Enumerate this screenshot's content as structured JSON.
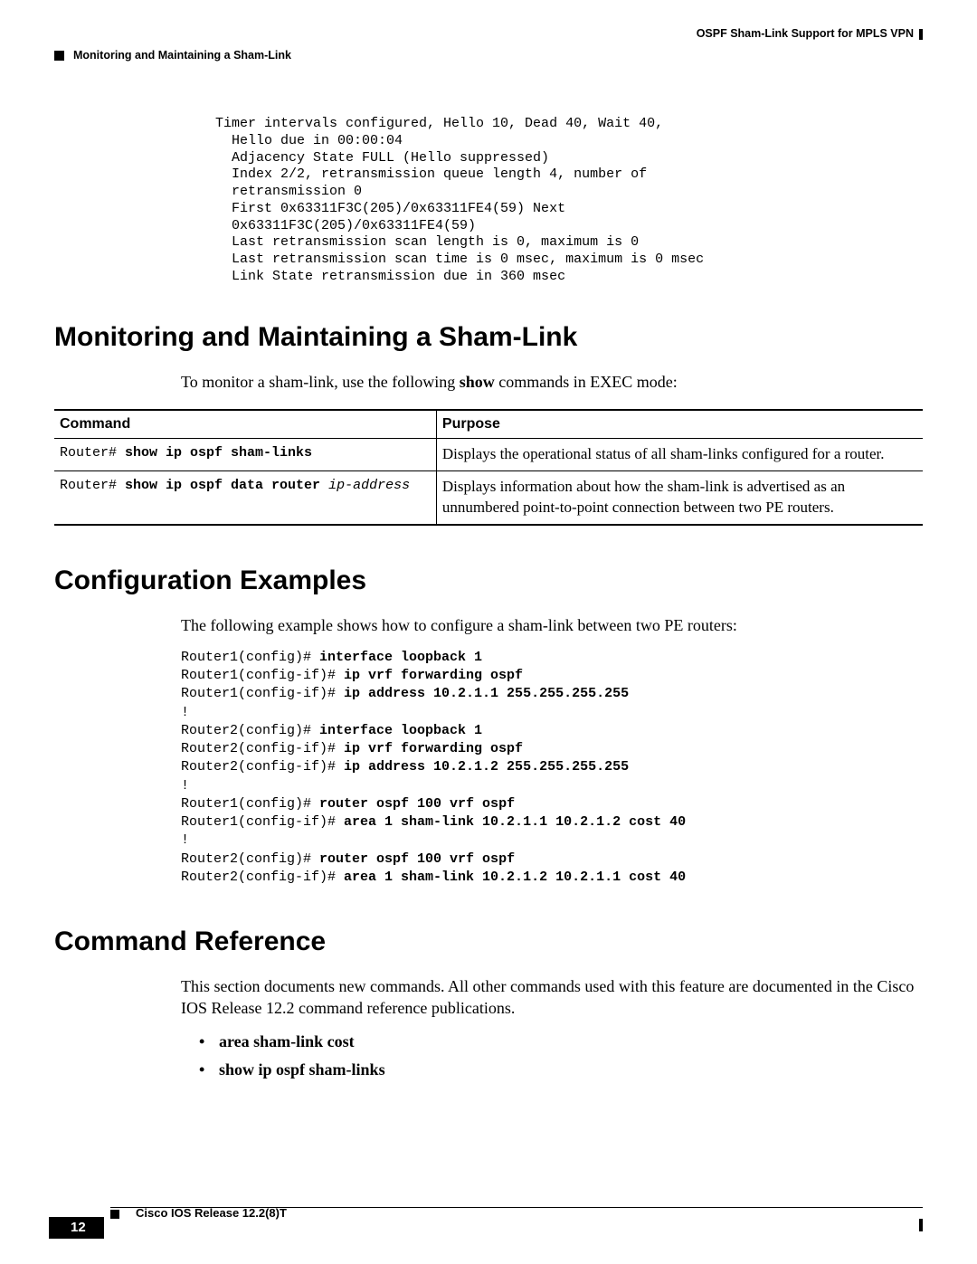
{
  "header": {
    "right": "OSPF Sham-Link Support for MPLS VPN",
    "left": "Monitoring and Maintaining a Sham-Link"
  },
  "pre_block": "  Timer intervals configured, Hello 10, Dead 40, Wait 40,\n    Hello due in 00:00:04\n    Adjacency State FULL (Hello suppressed)\n    Index 2/2, retransmission queue length 4, number of\n    retransmission 0\n    First 0x63311F3C(205)/0x63311FE4(59) Next\n    0x63311F3C(205)/0x63311FE4(59)\n    Last retransmission scan length is 0, maximum is 0\n    Last retransmission scan time is 0 msec, maximum is 0 msec\n    Link State retransmission due in 360 msec",
  "sec1": {
    "title": "Monitoring and Maintaining a Sham-Link",
    "intro_pre": "To monitor a sham-link, use the following ",
    "intro_bold": "show",
    "intro_post": " commands in EXEC mode:"
  },
  "table": {
    "h1": "Command",
    "h2": "Purpose",
    "rows": [
      {
        "prompt": "Router# ",
        "cmd": "show ip ospf sham-links",
        "arg": "",
        "purpose": "Displays the operational status of all sham-links configured for a router."
      },
      {
        "prompt": "Router# ",
        "cmd": "show ip ospf data router ",
        "arg": "ip-address",
        "purpose": "Displays information about how the sham-link is advertised as an unnumbered point-to-point connection between two PE routers."
      }
    ]
  },
  "sec2": {
    "title": "Configuration Examples",
    "intro": "The following example shows how to configure a sham-link between two PE routers:",
    "lines": [
      {
        "p": "Router1(config)# ",
        "c": "interface loopback 1"
      },
      {
        "p": "Router1(config-if)# ",
        "c": "ip vrf forwarding ospf"
      },
      {
        "p": "Router1(config-if)# ",
        "c": "ip address 10.2.1.1 255.255.255.255"
      },
      {
        "p": "!",
        "c": ""
      },
      {
        "p": "Router2(config)# ",
        "c": "interface loopback 1"
      },
      {
        "p": "Router2(config-if)# ",
        "c": "ip vrf forwarding ospf"
      },
      {
        "p": "Router2(config-if)# ",
        "c": "ip address 10.2.1.2 255.255.255.255"
      },
      {
        "p": "!",
        "c": ""
      },
      {
        "p": "Router1(config)# ",
        "c": "router ospf 100 vrf ospf"
      },
      {
        "p": "Router1(config-if)# ",
        "c": "area 1 sham-link 10.2.1.1 10.2.1.2 cost 40"
      },
      {
        "p": "!",
        "c": ""
      },
      {
        "p": "Router2(config)# ",
        "c": "router ospf 100 vrf ospf"
      },
      {
        "p": "Router2(config-if)# ",
        "c": "area 1 sham-link 10.2.1.2 10.2.1.1 cost 40"
      }
    ]
  },
  "sec3": {
    "title": "Command Reference",
    "intro": "This section documents new commands. All other commands used with this feature are documented in the Cisco IOS Release 12.2 command reference publications.",
    "items": [
      "area sham-link cost",
      "show ip ospf sham-links"
    ]
  },
  "footer": {
    "release": "Cisco IOS Release 12.2(8)T",
    "page": "12"
  }
}
